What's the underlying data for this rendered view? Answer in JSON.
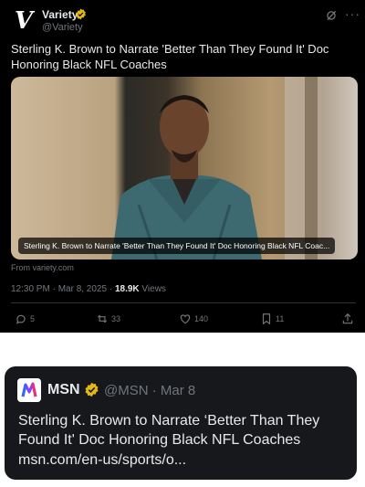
{
  "tweet": {
    "account_name": "Variety",
    "handle": "@Variety",
    "logo_letter": "V",
    "text": "Sterling K. Brown to Narrate 'Better Than They Found It' Doc Honoring Black NFL Coaches",
    "caption": "Sterling K. Brown to Narrate 'Better Than They Found It' Doc Honoring Black NFL Coac...",
    "from": "From variety.com",
    "time": "12:30 PM · Mar 8, 2025 · ",
    "views_count": "18.9K",
    "views_label": " Views",
    "replies": "5",
    "reposts": "33",
    "likes": "140",
    "bookmarks": "11",
    "more": "···"
  },
  "card": {
    "account_name": "MSN",
    "handle_date": "@MSN · Mar 8",
    "text": "Sterling K. Brown to Narrate ‘Better Than They Found It' Doc Honoring Black NFL Coaches",
    "link": "msn.com/en-us/sports/o..."
  },
  "colors": {
    "background_dark": "#000000",
    "card_background": "#16181c",
    "text_primary": "#e7e9ea",
    "text_secondary": "#71767b",
    "verified_gold": "#e2b719"
  },
  "icons": [
    "verified-gold-badge-icon",
    "grok-icon",
    "more-icon",
    "reply-icon",
    "repost-icon",
    "like-icon",
    "bookmark-icon",
    "share-icon",
    "msn-logo-icon"
  ]
}
